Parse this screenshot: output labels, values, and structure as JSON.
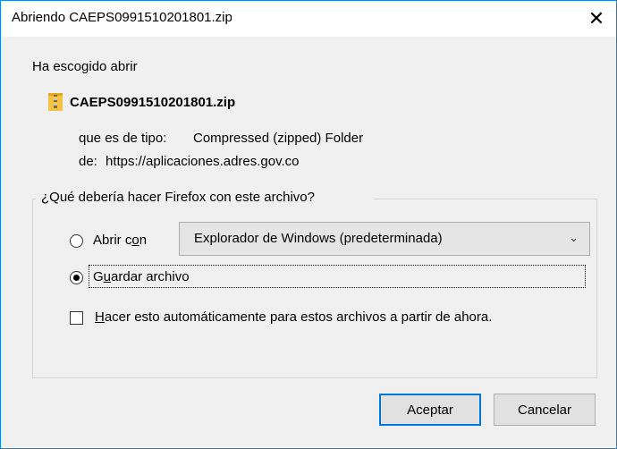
{
  "window": {
    "title": "Abriendo CAEPS0991510201801.zip",
    "close_icon": "close-icon"
  },
  "dialog": {
    "intro": "Ha escogido abrir",
    "file": {
      "icon": "zip-folder-icon",
      "name": "CAEPS0991510201801.zip",
      "type_label": "que es de tipo:",
      "type_value": "Compressed (zipped) Folder",
      "from_label": "de:",
      "from_value": "https://aplicaciones.adres.gov.co"
    },
    "question": "¿Qué debería hacer Firefox con este archivo?",
    "open_with": {
      "label_before": "Abrir c",
      "label_underlined": "o",
      "label_after": "n",
      "selected": false,
      "app": "Explorador de Windows (predeterminada)"
    },
    "save_file": {
      "label_before": "G",
      "label_underlined": "u",
      "label_after": "ardar archivo",
      "selected": true
    },
    "auto": {
      "label_underlined": "H",
      "label_after": "acer esto automáticamente para estos archivos a partir de ahora.",
      "checked": false
    },
    "buttons": {
      "accept": "Aceptar",
      "cancel": "Cancelar"
    }
  },
  "colors": {
    "accent": "#0078d7",
    "window_border": "#1883d7",
    "background": "#f0f0f0"
  }
}
